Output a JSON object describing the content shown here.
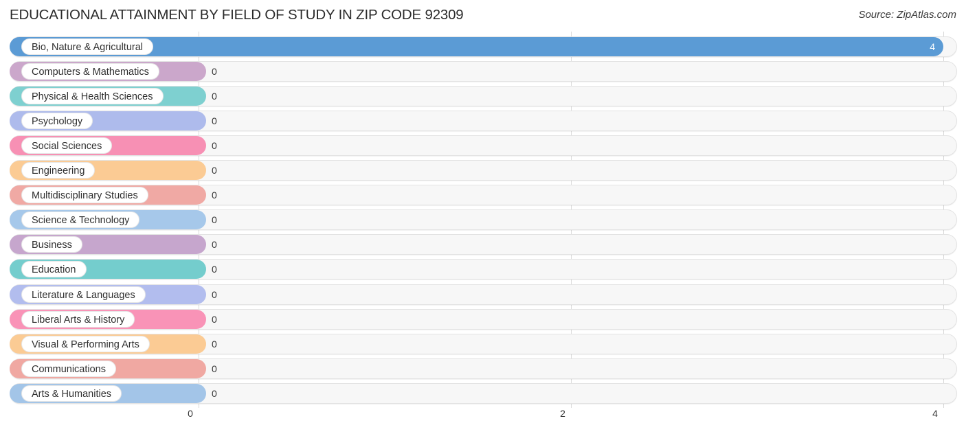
{
  "header": {
    "title": "EDUCATIONAL ATTAINMENT BY FIELD OF STUDY IN ZIP CODE 92309",
    "source": "Source: ZipAtlas.com"
  },
  "chart_data": {
    "type": "bar",
    "orientation": "horizontal",
    "title": "EDUCATIONAL ATTAINMENT BY FIELD OF STUDY IN ZIP CODE 92309",
    "xlabel": "",
    "ylabel": "",
    "xlim": [
      0,
      4
    ],
    "grid": true,
    "legend": "none",
    "xticks": [
      "0",
      "2",
      "4"
    ],
    "xtick_values": [
      0,
      2,
      4
    ],
    "categories": [
      "Bio, Nature & Agricultural",
      "Computers & Mathematics",
      "Physical & Health Sciences",
      "Psychology",
      "Social Sciences",
      "Engineering",
      "Multidisciplinary Studies",
      "Science & Technology",
      "Business",
      "Education",
      "Literature & Languages",
      "Liberal Arts & History",
      "Visual & Performing Arts",
      "Communications",
      "Arts & Humanities"
    ],
    "values": [
      4,
      0,
      0,
      0,
      0,
      0,
      0,
      0,
      0,
      0,
      0,
      0,
      0,
      0,
      0
    ],
    "value_labels": [
      "4",
      "0",
      "0",
      "0",
      "0",
      "0",
      "0",
      "0",
      "0",
      "0",
      "0",
      "0",
      "0",
      "0",
      "0"
    ],
    "colors": [
      "#5b9bd5",
      "#cba7cb",
      "#7ed0d0",
      "#aebbec",
      "#f790b4",
      "#fbcb94",
      "#f0a9a4",
      "#a6c8ea",
      "#c6a6cd",
      "#74cdcd",
      "#b2bdee",
      "#f993b7",
      "#fbcb94",
      "#f0a8a2",
      "#a3c5e8"
    ]
  }
}
